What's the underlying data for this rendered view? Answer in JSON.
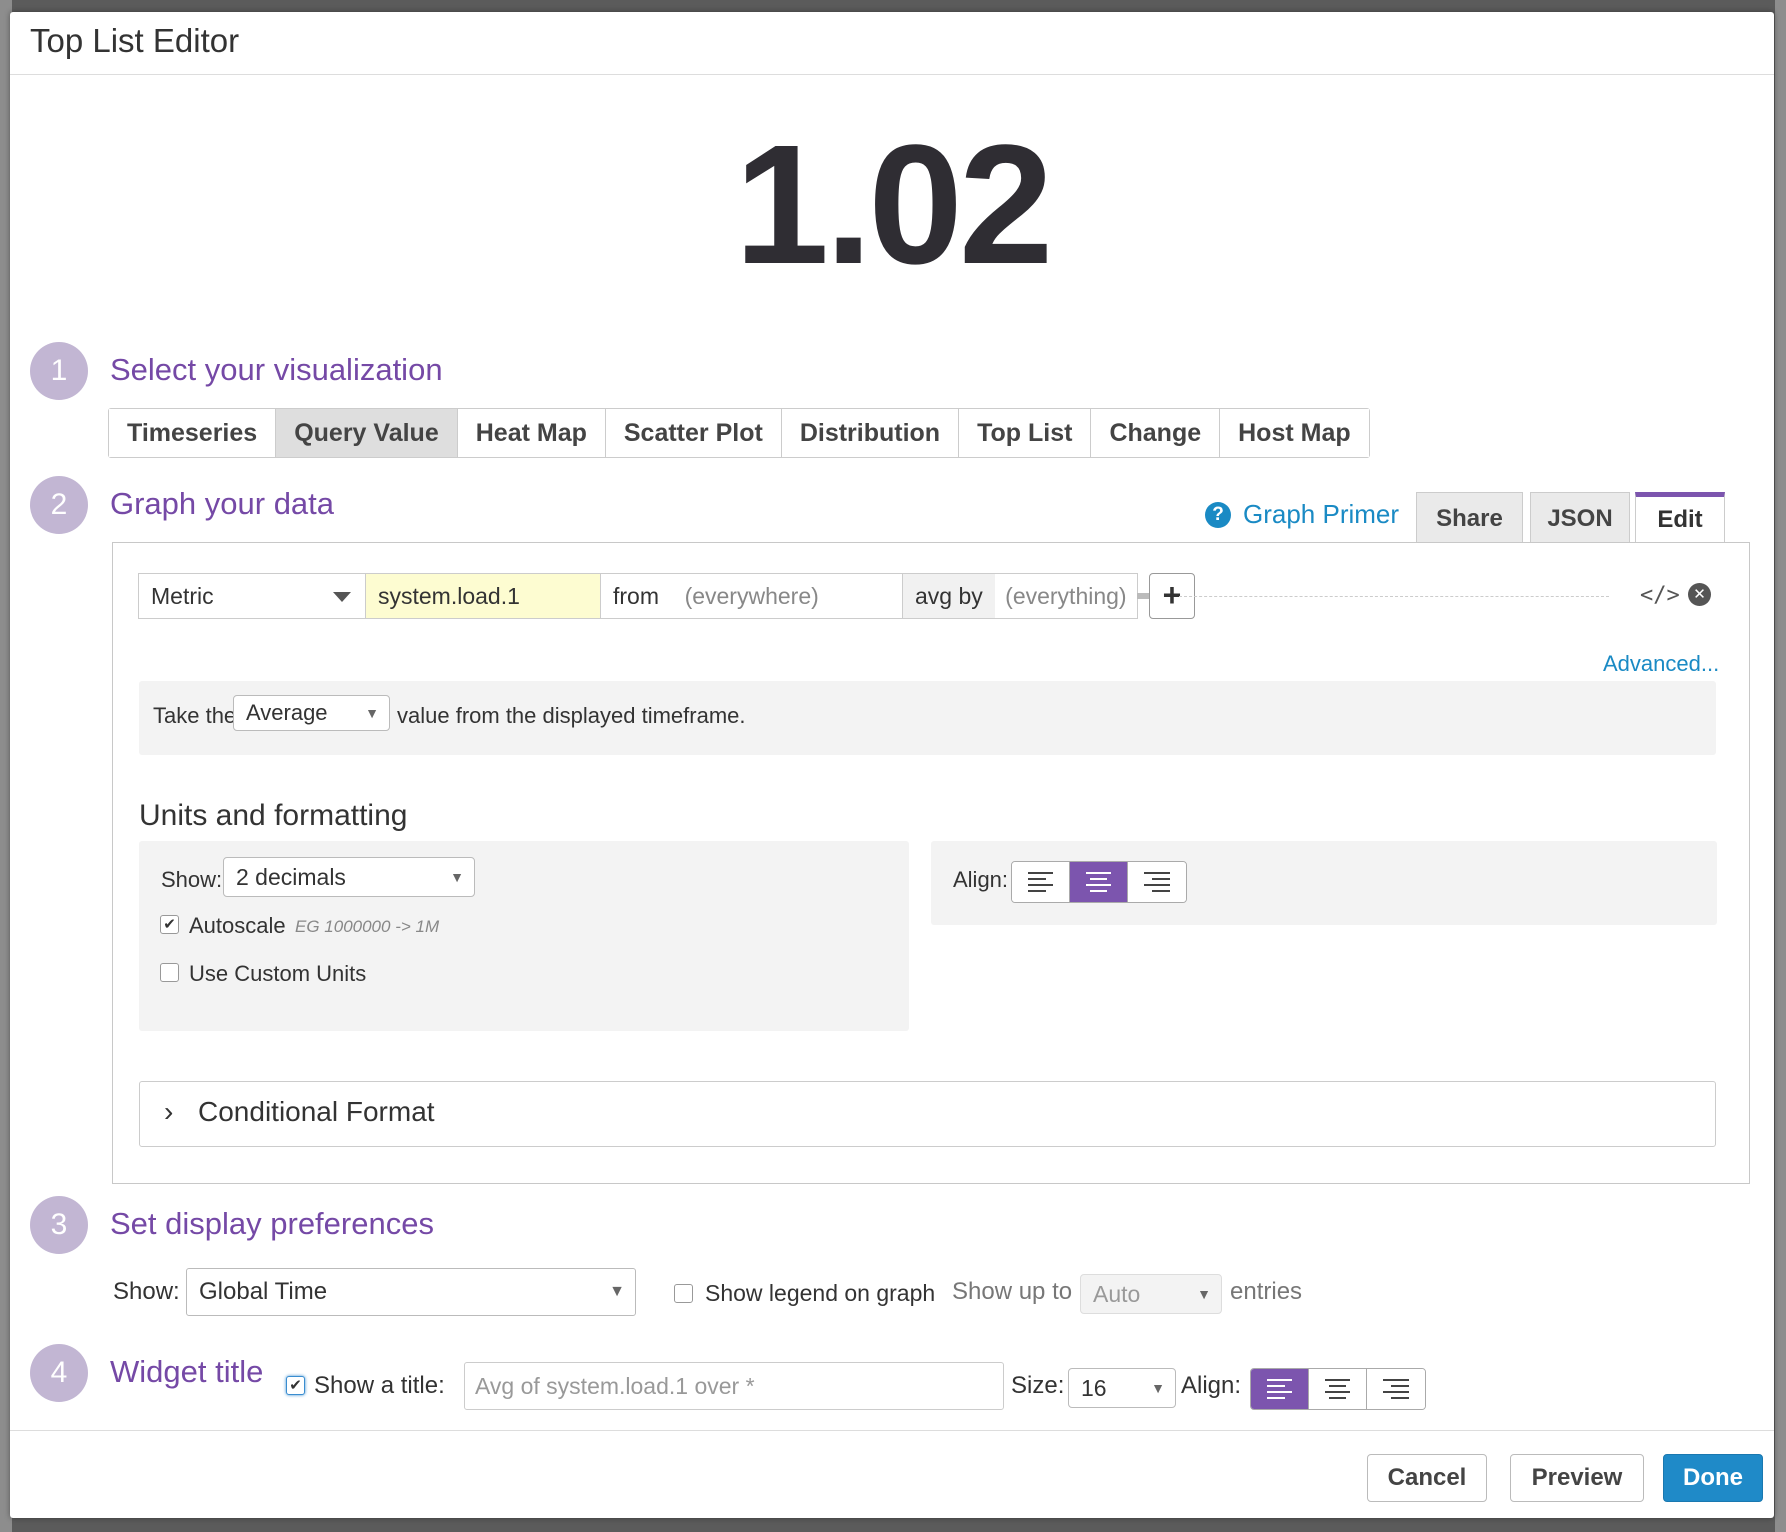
{
  "header": {
    "title": "Top List Editor"
  },
  "preview": {
    "value": "1.02"
  },
  "steps": [
    {
      "number": "1",
      "title": "Select your visualization"
    },
    {
      "number": "2",
      "title": "Graph your data"
    },
    {
      "number": "3",
      "title": "Set display preferences"
    },
    {
      "number": "4",
      "title": "Widget title"
    }
  ],
  "viz_tabs": [
    "Timeseries",
    "Query Value",
    "Heat Map",
    "Scatter Plot",
    "Distribution",
    "Top List",
    "Change",
    "Host Map"
  ],
  "viz_active": "Query Value",
  "graph_primer": "Graph Primer",
  "editor_tabs": [
    "Share",
    "JSON",
    "Edit"
  ],
  "editor_active": "Edit",
  "query": {
    "type": "Metric",
    "metric": "system.load.1",
    "from_label": "from",
    "from_value": "(everywhere)",
    "avg_label": "avg by",
    "avg_value": "(everything)",
    "advanced": "Advanced..."
  },
  "aggregation": {
    "prefix": "Take the",
    "value": "Average",
    "suffix": "value from the displayed timeframe."
  },
  "units": {
    "title": "Units and formatting",
    "show_label": "Show:",
    "show_value": "2 decimals",
    "autoscale_label": "Autoscale",
    "autoscale_checked": true,
    "autoscale_hint": "EG 1000000 -> 1M",
    "custom_units_label": "Use Custom Units",
    "custom_units_checked": false,
    "align_label": "Align:",
    "align_selected": "center"
  },
  "conditional_format": {
    "title": "Conditional Format"
  },
  "display": {
    "show_label": "Show:",
    "show_value": "Global Time",
    "legend_label": "Show legend on graph",
    "legend_checked": false,
    "show_up_to": "Show up to",
    "entries_value": "Auto",
    "entries_label": "entries"
  },
  "widget_title": {
    "show_title_label": "Show a title:",
    "show_title_checked": true,
    "placeholder": "Avg of system.load.1 over *",
    "size_label": "Size:",
    "size_value": "16",
    "align_label": "Align:",
    "align_selected": "left"
  },
  "footer": {
    "cancel": "Cancel",
    "preview": "Preview",
    "done": "Done"
  },
  "colors": {
    "accent": "#7c55ae",
    "step_circle": "#c2b6d3",
    "step_title": "#7549a6",
    "link": "#1a8ac4",
    "primary_button": "#1f8ac8",
    "metric_highlight": "#fdfcd1"
  }
}
